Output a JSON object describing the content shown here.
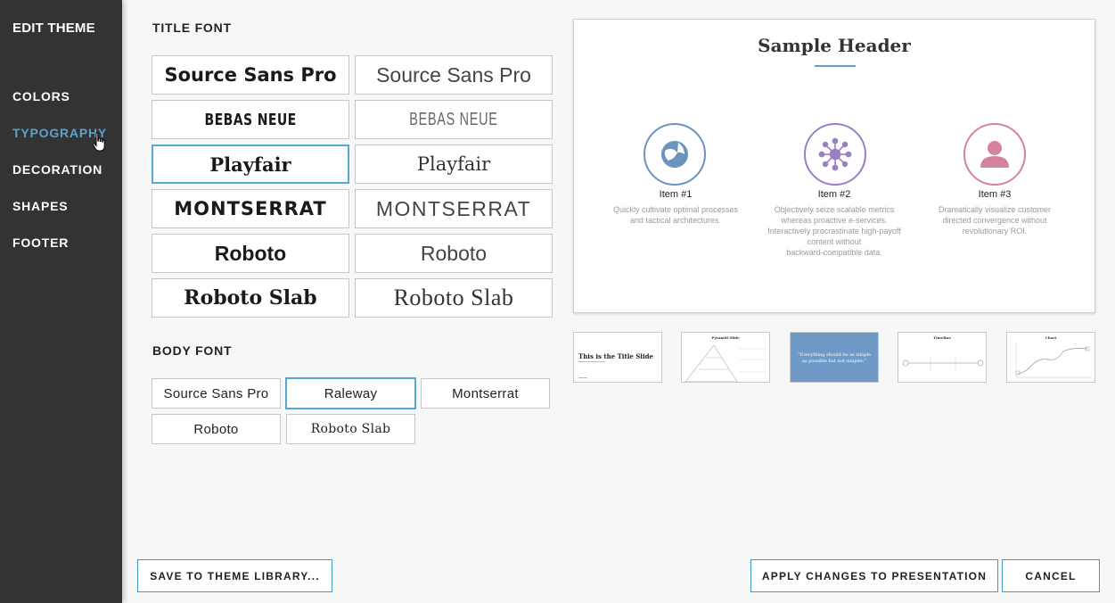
{
  "sidebar": {
    "title": "EDIT THEME",
    "items": [
      {
        "label": "COLORS"
      },
      {
        "label": "TYPOGRAPHY"
      },
      {
        "label": "DECORATION"
      },
      {
        "label": "SHAPES"
      },
      {
        "label": "FOOTER"
      }
    ],
    "active": "TYPOGRAPHY"
  },
  "title_font": {
    "label": "TITLE FONT",
    "options": [
      {
        "bold": "Source Sans Pro",
        "light": "Source Sans Pro"
      },
      {
        "bold": "BEBAS NEUE",
        "light": "BEBAS NEUE"
      },
      {
        "bold": "Playfair",
        "light": "Playfair"
      },
      {
        "bold": "MONTSERRAT",
        "light": "MONTSERRAT"
      },
      {
        "bold": "Roboto",
        "light": "Roboto"
      },
      {
        "bold": "Roboto Slab",
        "light": "Roboto Slab"
      }
    ],
    "selected": "Playfair bold"
  },
  "body_font": {
    "label": "BODY FONT",
    "options": [
      "Source Sans Pro",
      "Raleway",
      "Montserrat",
      "Roboto",
      "Roboto Slab"
    ],
    "selected": "Raleway"
  },
  "preview": {
    "header": "Sample Header",
    "items": [
      {
        "label": "Item #1",
        "desc": [
          "Quickly cultivate optimal processes",
          "and tactical architectures."
        ],
        "color": "#6b93bd",
        "icon": "beach-ball-icon"
      },
      {
        "label": "Item #2",
        "desc": [
          "Objectively seize scalable metrics",
          "whereas proactive e-services.",
          "Interactively procrastinate high-payoff",
          "content without",
          "backward-compatible data."
        ],
        "color": "#9b7fc0",
        "icon": "network-hub-icon"
      },
      {
        "label": "Item #3",
        "desc": [
          "Dramatically visualize customer",
          "directed convergence without",
          "revolutionary ROI."
        ],
        "color": "#d4839f",
        "icon": "person-icon"
      }
    ]
  },
  "thumbnails": {
    "title_slide": "This is the Title Slide",
    "pyramid": "Pyramid Slide",
    "quote": [
      "“Everything should be as simple",
      "as possible but not simpler.”"
    ],
    "timeline": "Timeline",
    "chart": "Chart"
  },
  "actions": {
    "save": "SAVE TO THEME LIBRARY...",
    "apply": "APPLY CHANGES TO PRESENTATION",
    "cancel": "CANCEL"
  },
  "colors": {
    "sidebar_bg": "#333333",
    "accent": "#55a8cf",
    "quote_bg": "#6f9ac7"
  }
}
